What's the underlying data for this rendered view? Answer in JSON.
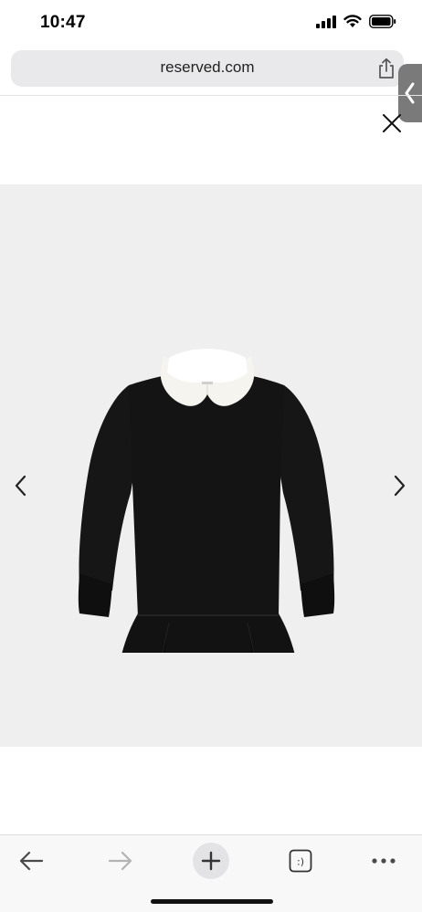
{
  "status_bar": {
    "time": "10:47",
    "icons": [
      "cellular-signal-icon",
      "wifi-icon",
      "battery-icon"
    ]
  },
  "browser": {
    "url": "reserved.com",
    "share_icon": "share-icon",
    "side_handle_icon": "chevron-left-icon"
  },
  "page": {
    "close_icon": "close-icon",
    "gallery": {
      "image": "black-dress-with-white-collar",
      "prev_icon": "chevron-left-icon",
      "next_icon": "chevron-right-icon"
    }
  },
  "toolbar": {
    "items": [
      "back-arrow-icon",
      "forward-arrow-icon",
      "new-tab-plus-icon",
      "tabs-icon",
      "more-icon"
    ],
    "tabs_label": ":)"
  },
  "colors": {
    "url_bar_bg": "#e9e9eb",
    "gallery_bg": "#efefef",
    "garment": "#141414",
    "collar": "#f6f4ef",
    "handle": "#7a7a7a"
  }
}
